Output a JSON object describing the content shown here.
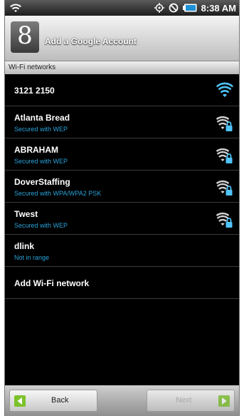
{
  "status_bar": {
    "time": "8:38 AM"
  },
  "header": {
    "title": "Add a Google Account",
    "logo_letter": "8"
  },
  "section_header": "Wi-Fi networks",
  "networks": [
    {
      "name": "3121 2150",
      "status": "",
      "icon": "wifi-open-icon"
    },
    {
      "name": "Atlanta Bread",
      "status": "Secured with WEP",
      "icon": "wifi-lock-icon"
    },
    {
      "name": "ABRAHAM",
      "status": "Secured with WEP",
      "icon": "wifi-lock-icon"
    },
    {
      "name": "DoverStaffing",
      "status": "Secured with WPA/WPA2 PSK",
      "icon": "wifi-lock-icon"
    },
    {
      "name": "Twest",
      "status": "Secured with WEP",
      "icon": "wifi-lock-icon"
    },
    {
      "name": "dlink",
      "status": "Not in range",
      "icon": ""
    }
  ],
  "add_network_label": "Add Wi-Fi network",
  "footer": {
    "back_label": "Back",
    "next_label": "Next"
  },
  "colors": {
    "accent": "#2aa2d8",
    "wifi_signal": "#4fc3f7",
    "button_green": "#7cc22b"
  }
}
